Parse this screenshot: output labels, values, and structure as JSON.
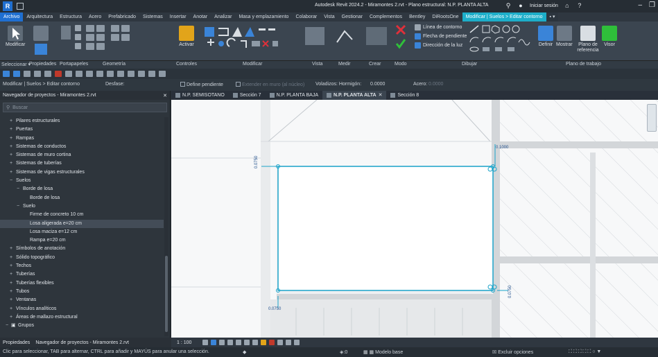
{
  "title_bar": {
    "title": "Autodesk Revit 2024.2 - Miramontes 2.rvt - Plano estructural: N.P. PLANTA ALTA",
    "signin": "Iniciar sesión"
  },
  "menu_tabs": [
    "Archivo",
    "Arquitectura",
    "Estructura",
    "Acero",
    "Prefabricado",
    "Sistemas",
    "Insertar",
    "Anotar",
    "Analizar",
    "Masa y emplazamiento",
    "Colaborar",
    "Vista",
    "Gestionar",
    "Complementos",
    "Bentley",
    "DiRootsOne",
    "Modificar | Suelos > Editar contorno"
  ],
  "ribbon": {
    "modificar": "Modificar",
    "activar": "Activar",
    "linea_contorno": "Línea de contorno",
    "flecha_pendiente": "Flecha de pendiente",
    "direccion_luz": "Dirección de la luz",
    "definir": "Definir",
    "mostrar": "Mostrar",
    "plano_referencia": "Plano de referencia",
    "visor": "Visor"
  },
  "panel_labels": [
    "Seleccionar ▾",
    "Propiedades",
    "Portapapeles",
    "Geometría",
    "Controles",
    "Modificar",
    "Vista",
    "Medir",
    "Crear",
    "Modo",
    "Dibujar",
    "Plano de trabajo"
  ],
  "options_bar": {
    "context": "Modificar | Suelos > Editar contorno",
    "desfase": "Desfase:",
    "define_pendiente": "Define pendiente",
    "extender": "Extender en muro (al núcleo)",
    "voladizos_hormigon": "Voladizos: Hormigón:",
    "hormigon_value": "0.0000",
    "acero": "Acero:",
    "acero_value": "0.0000"
  },
  "project_browser": {
    "header": "Navegador de proyectos - Miramontes 2.rvt",
    "search_placeholder": "Buscar",
    "items": [
      {
        "label": "Pilares estructurales",
        "level": 1,
        "exp": "+"
      },
      {
        "label": "Puertas",
        "level": 1,
        "exp": "+"
      },
      {
        "label": "Rampas",
        "level": 1,
        "exp": "+"
      },
      {
        "label": "Sistemas de conductos",
        "level": 1,
        "exp": "+"
      },
      {
        "label": "Sistemas de muro cortina",
        "level": 1,
        "exp": "+"
      },
      {
        "label": "Sistemas de tuberías",
        "level": 1,
        "exp": "+"
      },
      {
        "label": "Sistemas de vigas estructurales",
        "level": 1,
        "exp": "+"
      },
      {
        "label": "Suelos",
        "level": 1,
        "exp": "−"
      },
      {
        "label": "Borde de losa",
        "level": 2,
        "exp": "−"
      },
      {
        "label": "Borde de losa",
        "level": 3,
        "exp": ""
      },
      {
        "label": "Suelo",
        "level": 2,
        "exp": "−"
      },
      {
        "label": "Firme de concreto 10 cm",
        "level": 3,
        "exp": ""
      },
      {
        "label": "Losa aligerada e=20 cm",
        "level": 3,
        "exp": "",
        "selected": true
      },
      {
        "label": "Losa maciza e=12 cm",
        "level": 3,
        "exp": ""
      },
      {
        "label": "Rampa e=20 cm",
        "level": 3,
        "exp": ""
      },
      {
        "label": "Símbolos de anotación",
        "level": 1,
        "exp": "+"
      },
      {
        "label": "Sólido topográfico",
        "level": 1,
        "exp": "+"
      },
      {
        "label": "Techos",
        "level": 1,
        "exp": "+"
      },
      {
        "label": "Tuberías",
        "level": 1,
        "exp": "+"
      },
      {
        "label": "Tuberías flexibles",
        "level": 1,
        "exp": "+"
      },
      {
        "label": "Tubos",
        "level": 1,
        "exp": "+"
      },
      {
        "label": "Ventanas",
        "level": 1,
        "exp": "+"
      },
      {
        "label": "Vínculos analíticos",
        "level": 1,
        "exp": "+"
      },
      {
        "label": "Áreas de mallazo estructural",
        "level": 1,
        "exp": "+"
      },
      {
        "label": "Grupos",
        "level": 0,
        "exp": "−"
      }
    ]
  },
  "view_tabs": [
    {
      "label": "N.P. SEMISOTANO",
      "active": false
    },
    {
      "label": "Sección 7",
      "active": false
    },
    {
      "label": "N.P. PLANTA BAJA",
      "active": false
    },
    {
      "label": "N.P. PLANTA ALTA",
      "active": true
    },
    {
      "label": "Sección 8",
      "active": false
    }
  ],
  "canvas": {
    "dim_top_right": "0.1000",
    "dim_left": "0.0750",
    "dim_bottom_left": "0.0750",
    "dim_bottom_right": "0.0750"
  },
  "bottom_tabs": {
    "propiedades": "Propiedades",
    "navegador": "Navegador de proyectos - Miramontes 2.rvt"
  },
  "view_control": {
    "scale": "1 : 100"
  },
  "status_bar": {
    "hint": "Clic para seleccionar, TAB para alternar, CTRL para añadir y MAYÚS para anular una selección.",
    "coord": ":0",
    "modelo_base": "Modelo base",
    "excluir": "Excluir opciones"
  },
  "colors": {
    "accent_blue": "#1f6fd1",
    "context_cyan": "#1daec9",
    "sketch_line": "#1aa3c9",
    "finish_green": "#2fbf3a",
    "cancel_red": "#e0303a"
  }
}
